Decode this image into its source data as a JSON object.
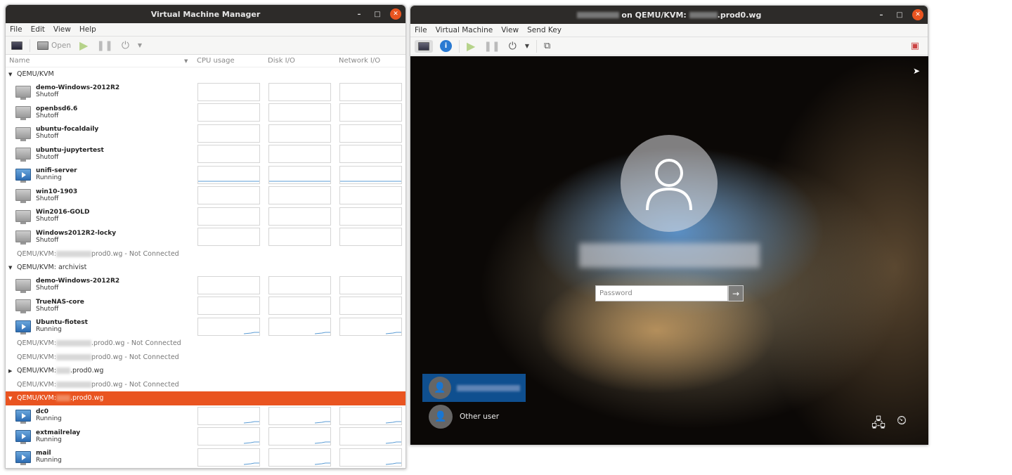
{
  "manager": {
    "title": "Virtual Machine Manager",
    "menu": [
      "File",
      "Edit",
      "View",
      "Help"
    ],
    "toolbar": {
      "open": "Open"
    },
    "columns": [
      "Name",
      "CPU usage",
      "Disk I/O",
      "Network I/O"
    ],
    "groups": [
      {
        "label": "QEMU/KVM",
        "expanded": true,
        "vms": [
          {
            "name": "demo-Windows-2012R2",
            "status": "Shutoff"
          },
          {
            "name": "openbsd6.6",
            "status": "Shutoff"
          },
          {
            "name": "ubuntu-focaldaily",
            "status": "Shutoff"
          },
          {
            "name": "ubuntu-jupytertest",
            "status": "Shutoff"
          },
          {
            "name": "unifi-server",
            "status": "Running"
          },
          {
            "name": "win10-1903",
            "status": "Shutoff"
          },
          {
            "name": "Win2016-GOLD",
            "status": "Shutoff"
          },
          {
            "name": "Windows2012R2-locky",
            "status": "Shutoff"
          }
        ]
      },
      {
        "label": "QEMU/KVM:",
        "suffix": "prod0.wg - Not Connected",
        "nc": true
      },
      {
        "label": "QEMU/KVM: archivist",
        "expanded": true,
        "vms": [
          {
            "name": "demo-Windows-2012R2",
            "status": "Shutoff"
          },
          {
            "name": "TrueNAS-core",
            "status": "Shutoff"
          },
          {
            "name": "Ubuntu-fiotest",
            "status": "Running"
          }
        ]
      },
      {
        "label": "QEMU/KVM:",
        "suffix": ".prod0.wg - Not Connected",
        "nc": true
      },
      {
        "label": "QEMU/KVM:",
        "suffix": "prod0.wg - Not Connected",
        "nc": true
      },
      {
        "label": "QEMU/KVM:",
        "suffix": ".prod0.wg",
        "expanded": false
      },
      {
        "label": "QEMU/KVM:",
        "suffix": "prod0.wg - Not Connected",
        "nc": true
      },
      {
        "label": "QEMU/KVM:",
        "suffix": ".prod0.wg",
        "expanded": true,
        "selected": true,
        "vms": [
          {
            "name": "dc0",
            "status": "Running"
          },
          {
            "name": "extmailrelay",
            "status": "Running"
          },
          {
            "name": "mail",
            "status": "Running"
          }
        ]
      }
    ]
  },
  "console": {
    "title_mid": "on QEMU/KVM:",
    "title_end": ".prod0.wg",
    "menu": [
      "File",
      "Virtual Machine",
      "View",
      "Send Key"
    ],
    "login": {
      "password_placeholder": "Password",
      "other_user": "Other user"
    }
  },
  "colors": {
    "accent": "#e95420",
    "selected_user": "#0f4f8f",
    "titlebar": "#2d2b29"
  }
}
